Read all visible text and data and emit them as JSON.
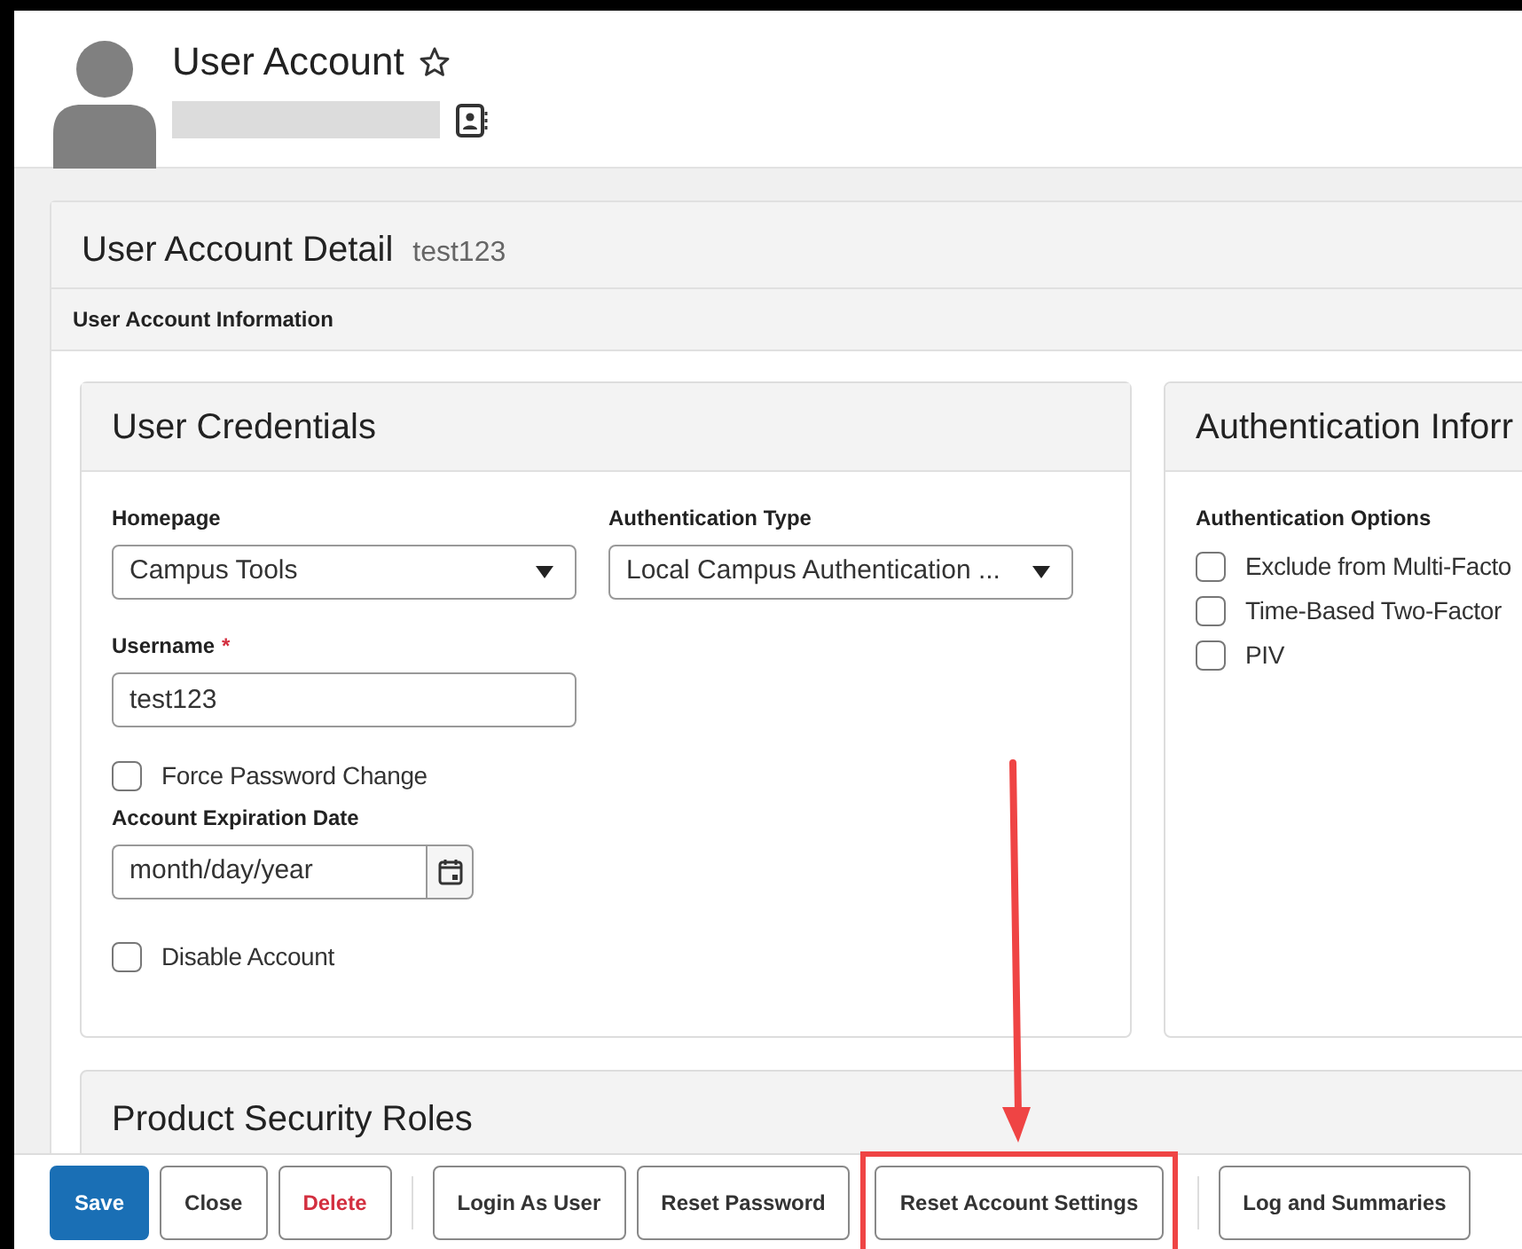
{
  "header": {
    "title": "User Account"
  },
  "detail": {
    "title": "User Account Detail",
    "username": "test123",
    "section": "User Account Information"
  },
  "credentials": {
    "title": "User Credentials",
    "homepage": {
      "label": "Homepage",
      "value": "Campus Tools"
    },
    "auth_type": {
      "label": "Authentication Type",
      "value": "Local Campus Authentication ..."
    },
    "username": {
      "label": "Username",
      "required_mark": "*",
      "value": "test123"
    },
    "force_password_change": {
      "label": "Force Password Change",
      "checked": false
    },
    "expiration": {
      "label": "Account Expiration Date",
      "placeholder": "month/day/year"
    },
    "disable_account": {
      "label": "Disable Account",
      "checked": false
    }
  },
  "authentication": {
    "title": "Authentication Inforr",
    "options_label": "Authentication Options",
    "options": [
      {
        "label": "Exclude from Multi-Facto",
        "checked": false
      },
      {
        "label": "Time-Based Two-Factor",
        "checked": false
      },
      {
        "label": "PIV",
        "checked": false
      }
    ]
  },
  "next_section": {
    "title": "Product Security Roles"
  },
  "buttons": [
    {
      "label": "Save",
      "kind": "primary",
      "highlighted": false
    },
    {
      "label": "Close",
      "kind": "plain",
      "highlighted": false
    },
    {
      "label": "Delete",
      "kind": "danger",
      "highlighted": false
    },
    {
      "kind": "separator"
    },
    {
      "label": "Login As User",
      "kind": "plain",
      "highlighted": false
    },
    {
      "label": "Reset Password",
      "kind": "plain",
      "highlighted": false
    },
    {
      "label": "Reset Account Settings",
      "kind": "plain",
      "highlighted": true
    },
    {
      "kind": "separator"
    },
    {
      "label": "Log and Summaries",
      "kind": "plain",
      "highlighted": false
    }
  ]
}
